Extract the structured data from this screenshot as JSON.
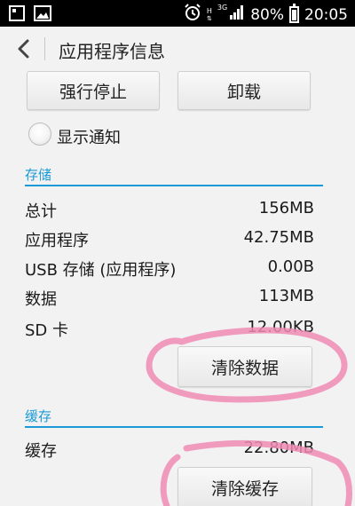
{
  "status_bar": {
    "icons_left": [
      "screenshot-icon",
      "picture-icon"
    ],
    "alarm_icon": "alarm-icon",
    "h_label": "H",
    "network_label": "3G",
    "battery": "80%",
    "time": "20:05"
  },
  "header": {
    "title": "应用程序信息"
  },
  "actions": {
    "force_stop": "强行停止",
    "uninstall": "卸载"
  },
  "notification": {
    "label": "显示通知"
  },
  "storage": {
    "heading": "存储",
    "rows": [
      {
        "label": "总计",
        "value": "156MB"
      },
      {
        "label": "应用程序",
        "value": "42.75MB"
      },
      {
        "label": "USB 存储 (应用程序)",
        "value": "0.00B"
      },
      {
        "label": "数据",
        "value": "113MB"
      },
      {
        "label": "SD 卡",
        "value": "12.00KB"
      }
    ],
    "clear_button": "清除数据"
  },
  "cache": {
    "heading": "缓存",
    "rows": [
      {
        "label": "缓存",
        "value": "22.80MB"
      }
    ],
    "clear_button": "清除缓存"
  },
  "colors": {
    "accent": "#1a9bd7",
    "annotation": "#f08cb4"
  }
}
